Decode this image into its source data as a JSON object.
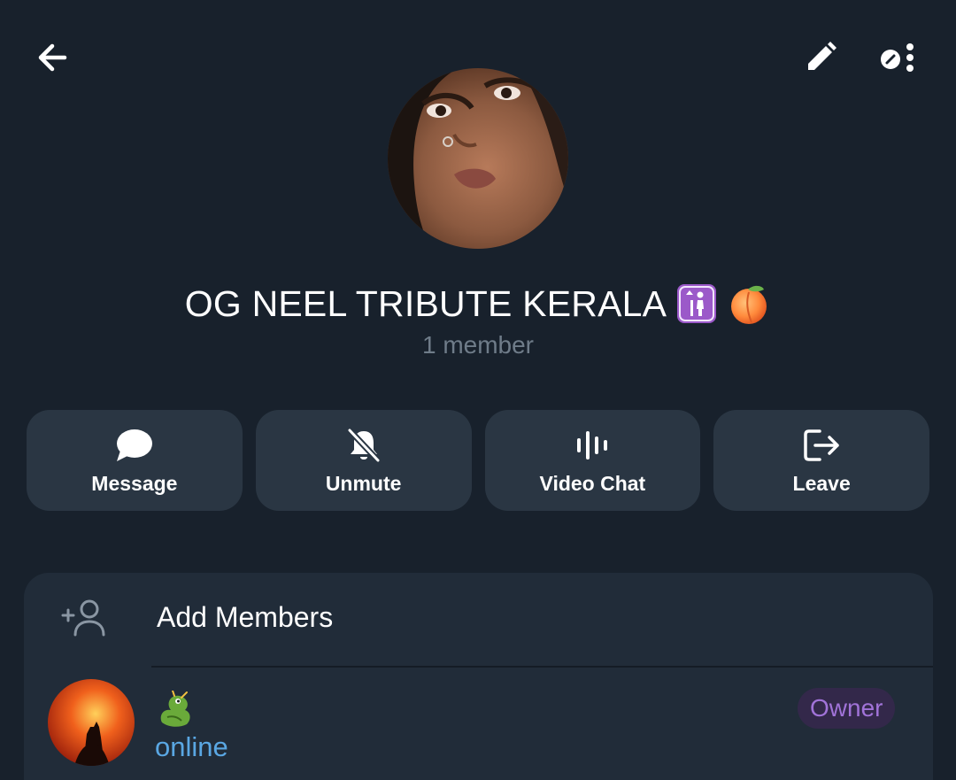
{
  "header": {
    "back_icon": "arrow-left-icon",
    "edit_icon": "pencil-icon",
    "more_icon": "more-vertical-icon"
  },
  "group": {
    "title": "OG NEEL TRIBUTE KERALA",
    "title_emojis": [
      "elevator-person-icon",
      "peach-emoji-icon"
    ],
    "member_count": "1 member"
  },
  "actions": [
    {
      "label": "Message",
      "icon": "chat-bubble-icon"
    },
    {
      "label": "Unmute",
      "icon": "bell-off-icon"
    },
    {
      "label": "Video Chat",
      "icon": "voice-bars-icon"
    },
    {
      "label": "Leave",
      "icon": "logout-icon"
    }
  ],
  "members_section": {
    "add_label": "Add Members",
    "add_icon": "add-person-icon",
    "members": [
      {
        "name_icon": "dragon-emoji-icon",
        "status": "online",
        "role": "Owner"
      }
    ]
  },
  "colors": {
    "background": "#18212c",
    "button_bg": "#2a3643",
    "card_bg": "#212c39",
    "online": "#5aa7e3",
    "owner_text": "#a173d8",
    "owner_bg": "#33284a"
  }
}
